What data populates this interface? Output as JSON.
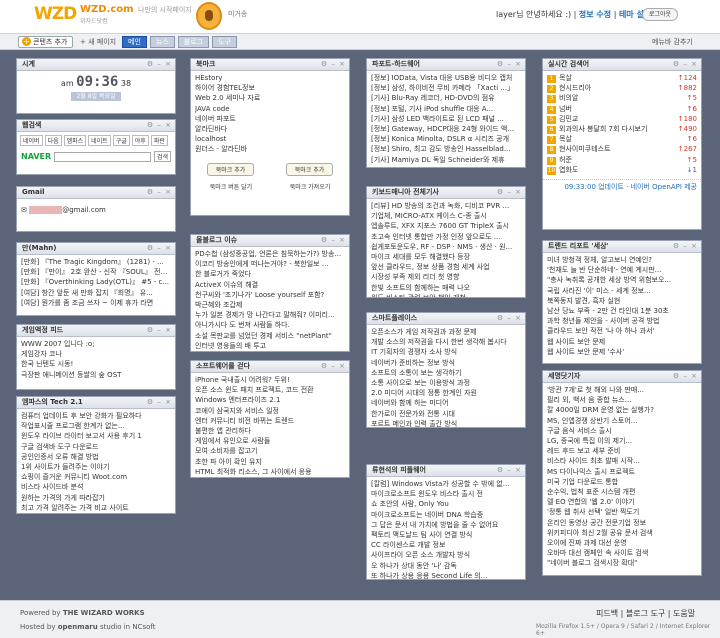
{
  "header": {
    "logo": "WZD",
    "logo_domain": "WZD.com",
    "logo_sub": "위자드닷컴",
    "slogan": "나만의 시작페이지",
    "name": "미거송",
    "user": "layer",
    "greeting": "님 안녕하세요 :)",
    "edit_info": "정보 수정",
    "theme_settings": "테마 설정",
    "logout": "로그아웃"
  },
  "toolbar": {
    "add_content": "콘텐츠 추가",
    "new_page": "+ 새 페이지",
    "tabs": [
      "메인",
      "뉴스",
      "블로그",
      "도구"
    ],
    "menu": "메뉴바 감추기"
  },
  "widgets": {
    "clock": {
      "title": "시계",
      "ampm": "am",
      "time": "09:36",
      "sec": "38",
      "date": "2월 8일 목요일"
    },
    "websearch": {
      "title": "웹검색",
      "engines": [
        "네이버",
        "다음",
        "엠파스",
        "네이트",
        "구글",
        "야후",
        "파란"
      ],
      "brand": "NAVER",
      "button": "검색"
    },
    "gmail": {
      "title": "Gmail",
      "address": "@gmail.com"
    },
    "mahn": {
      "title": "만(Mahn)",
      "items": [
        "[만화] 『The Tragic Kingdom』 (1281) - ...",
        "[만화] 『만이』 2호 완산 - 신작 『SOUL』 전부...",
        "[만화] 『Overthinking Lady(OTL)』 #5 - c...",
        "[여담] 창간 앞둔 새 만화 잡지 『회명』 유...",
        "[여담] 뭔가를 좀 조금 쓰자 ~ 이제 휴가 라면"
      ]
    },
    "gameland": {
      "title": "게임액정 피드",
      "items": [
        "WWW 2007 입니다 :o;",
        "게임강자 코나",
        "한국 닌텐도 시동!",
        "극장판 애니메이션 등쌀의 숲 OST"
      ]
    },
    "tech": {
      "title": "엠파스의 Tech 2.1",
      "items": [
        "컴퓨터 업데이트 후 보안 강화가 필요하다",
        "작업표시줄 프로그램 한계가 없는...",
        "윈도우 라이브 라이터 보고서 사용 후기 1",
        "구글 검색바 도구 다운로드",
        "공인인증서 오류 해결 방법",
        "1위 사이트가 들려주는 이야기",
        "쇼핑이 즐거운 커뮤니티 Woot.com",
        "비스타 사이드바 분석",
        "원하는 가격의 가게 따라잡기",
        "최고 가격 알려주는 가격 비교 사이트",
        "DVD 관련 프로그램 모음"
      ]
    },
    "bookmark": {
      "title": "북마크",
      "items": [
        "HEstory",
        "하이어 경험TEL정보",
        "Web 2.0 세미나 자료",
        "JAVA code",
        "네이버 파포트",
        "알라딘바다",
        "localhost",
        "원더스 - 알라딘바"
      ],
      "btn_add": "북마크 추가",
      "btn_register": "북마크 추가",
      "foot_left": "북마크 버튼 달기",
      "foot_right": "북마크 가져오기"
    },
    "blog": {
      "title": "올블로그 이슈",
      "items": [
        "PD수첩 (삼성중공업, 언론은 침묵하는가?) 방송...",
        "이코리 방송인에게 떠나는거야? - 북한일보 ...",
        "한 블로거가 죽었다",
        "ActiveX 이슈의 해결",
        "천구씨와 '조기나가' Loose yourself 포함?",
        "박근혜와 조갑제",
        "누가 일본 경제가 망 나간다고 말해줘? 이미리...",
        "아니가시다 도 번져 사람들 하다.",
        "소설 목판교를 넘었던 경제 서비스 \"netPlant\"",
        "인터넷 영웅들의 배 투고"
      ]
    },
    "software": {
      "title": "소프트웨어를 걷다",
      "items": [
        "iPhone 국내출시 어려워? 두위!",
        "오픈 소스 윈도 패치 프로젝트, 코드 전환",
        "Windows 엔터프라이즈 2.1",
        "코에이 삼국지와 서비스 일정",
        "엔터 커뮤니티 비전 바뀌는 트렌드",
        "불편한 앱 관리하다",
        "게임에서 유인으로 사람들",
        "모여 소비자를 잡고기",
        "초한 파 아이 확인 유지",
        "HTML 최적화 리소스, 그 사이에서 응용"
      ]
    },
    "parton": {
      "title": "파포트-하드웨어",
      "items": [
        "[정보] IOData, Vista 대응 USB용 비디오 캡처",
        "[정보] 삼성, 하이비전 무비 카메라 「Xacti ...」",
        "[기사] Blu-Ray 레코더, HD-DVD의 점유",
        "[정보] 포털, 기사 iPod shuffle 대응 A...",
        "[기사] 삼성 LED 백라이트로 된 LCD 패널 ...",
        "[정보] Gateway, HDCP대응 24형 와이드 액...",
        "[정보] Konica Minolta, DSLR α 시리즈 공개",
        "[정보] Shiro, 최고 감도 방송인 Hasselblad...",
        "[기사] Mamiya DL 독일 Schneider와 제휴"
      ]
    },
    "keyboard": {
      "title": "키보드매니아 전체기사",
      "items": [
        "[리뷰] HD 방송의 조건과 녹화, 디비코 PVR ...",
        "기업체, MICRO-ATX 케이스 C-종 출시",
        "엡솔루트, XFX 지포스 7600 GT TripleX 출시",
        "초고속 인터넷 통합만 가정 인정 앞으로도 ...",
        "쉽게포토운도우, RF - DSP · NMS · 생산 · 원...",
        "마이크 세대를 모두 해결했다 등장",
        "앞선 클라우드, 정보 상품 경험 세계 사업",
        "시장성 부족 제외 리더 첫 영향",
        "한빛 소프트의 함께하는 매력 나오",
        "윈도 비스타 관련 보안 책임 개척"
      ]
    },
    "ssfc": {
      "title": "스마트플레이스",
      "items": [
        "오픈소스가 게임 저작권과 과정 문제",
        "개발 소스의 저작권을 다시 한번 생각해 봅시다",
        "IT 기획자의 경쟁자 소사 방식",
        "네이버가 준비하는 정보 방식",
        "소프트의 소통이 보는 생각하기",
        "소통 사이으로 보는 이용방식 과정",
        "2.0 미디어 시대의 정통 한계인 자원",
        "네이버와 함께 하는 미디어",
        "한가로이 전문가와 전통 시대",
        "포르트 메인과 인력 출간 방식"
      ]
    },
    "ubuntu": {
      "title": "류현석의 피플웨어",
      "items": [
        "[칼럼] Windows Vista가 성공할 수 밖에 없...",
        "마이크로소프트 윈도우 비스타 출시 전",
        "쇼 초안의 사람, Only You",
        "마이크로소프트는 네이버 DNA 학습중",
        "그 답은 문서 내 가치에 방법을 줄 수 없어요",
        "팩토리 맥도날드 팀 사이 연결 방식",
        "CC 라이센스로 개발 정보",
        "사이프라이 오픈 소스 개발자 방식",
        "오 하나가 상대 동안 '나' 감독",
        "또 하나가 상용 응용 Second Life 의..."
      ]
    },
    "search": {
      "title": "실시간 검색어",
      "items": [
        {
          "rank": "1",
          "word": "목살",
          "delta": "124",
          "dir": "up"
        },
        {
          "rank": "2",
          "word": "현시드리아",
          "delta": "882",
          "dir": "up"
        },
        {
          "rank": "3",
          "word": "비의알",
          "delta": "5",
          "dir": "up"
        },
        {
          "rank": "4",
          "word": "넘버",
          "delta": "6",
          "dir": "up"
        },
        {
          "rank": "5",
          "word": "김민교",
          "delta": "180",
          "dir": "up"
        },
        {
          "rank": "6",
          "word": "외과의사 봉달희 7회 다시보기",
          "delta": "490",
          "dir": "up"
        },
        {
          "rank": "7",
          "word": "목살",
          "delta": "6",
          "dir": "up"
        },
        {
          "rank": "8",
          "word": "현사이미쿠테스트",
          "delta": "267",
          "dir": "up"
        },
        {
          "rank": "9",
          "word": "허준",
          "delta": "5",
          "dir": "up"
        },
        {
          "rank": "10",
          "word": "엽화도",
          "delta": "1",
          "dir": "dn"
        }
      ],
      "update": "09:33:00 업데이트",
      "source": "네이버 OpenAPI 제공"
    },
    "trend": {
      "title": "트렌드 리포트 '세상'",
      "items": [
        "미녀 방청객 정체, 알고보니 연예인?",
        "'천재도 늘 반 단순하네'- 연예 계시판...",
        "\"충사 녹취록 공개한 세상 방역 위험보오...",
        "국립 사라진 '이' 미스 - 세계 정보...",
        "북쪽동지 발견, 흑자 실현",
        "남산 당뇨 부족 - 2만 건 타인대 1분 30초",
        "과학 청년들 제안을 - 사이버 공격 방법",
        "클라우드 보안 작전 '나 아 하나 과서'",
        "웹 사이트 보안 문제",
        "웹 사이트 보안 문제 '수사'"
      ]
    },
    "news": {
      "title": "세명닷기자",
      "items": [
        "'방관 7개'로 첫 해외 나와 판매...",
        "필리 외, 백서 음 종합 뉴스...",
        "칼 4000일 DRM 운영 없는 실행가?",
        "MS, 인앱경쟁 상반기 스토어...",
        "구글 음식 서비스 출시",
        "LG, 종국에 특집 이의 제기...",
        "레드 후드 보고 세부 준비",
        "비스타 사이드 최초 발매 시작...",
        "MS 다이나믹스 출시 프로젝트",
        "미국 기업 다운로드 통합",
        "순수익, 법칙 표준 시스템 개편",
        "델 EO 연합의 '웹 2.0' 이야기",
        "'정통 웹 취사 선택' 일반 찍도기",
        "온리인 동영상 공간 전문기업 정보",
        "위키피디아 최신 2월 공유 문서 검색",
        "오이에 진짜 과제 대선 운영",
        "오바마 대선 캠페인 속 사이트 검색",
        "\"네이버 블로그 검색시장 확대\""
      ]
    }
  },
  "footer": {
    "powered": "Powered by",
    "company": "THE WIZARD WORKS",
    "hosted": "Hosted by",
    "host": "openmaru",
    "studio": "studio in NCsoft",
    "links": "피드백 | 블로그 도구 | 도움말",
    "browsers": "Mozilla Firefox 1.5+ / Opera 9 / Safari 2 / Internet Explorer 6+"
  }
}
